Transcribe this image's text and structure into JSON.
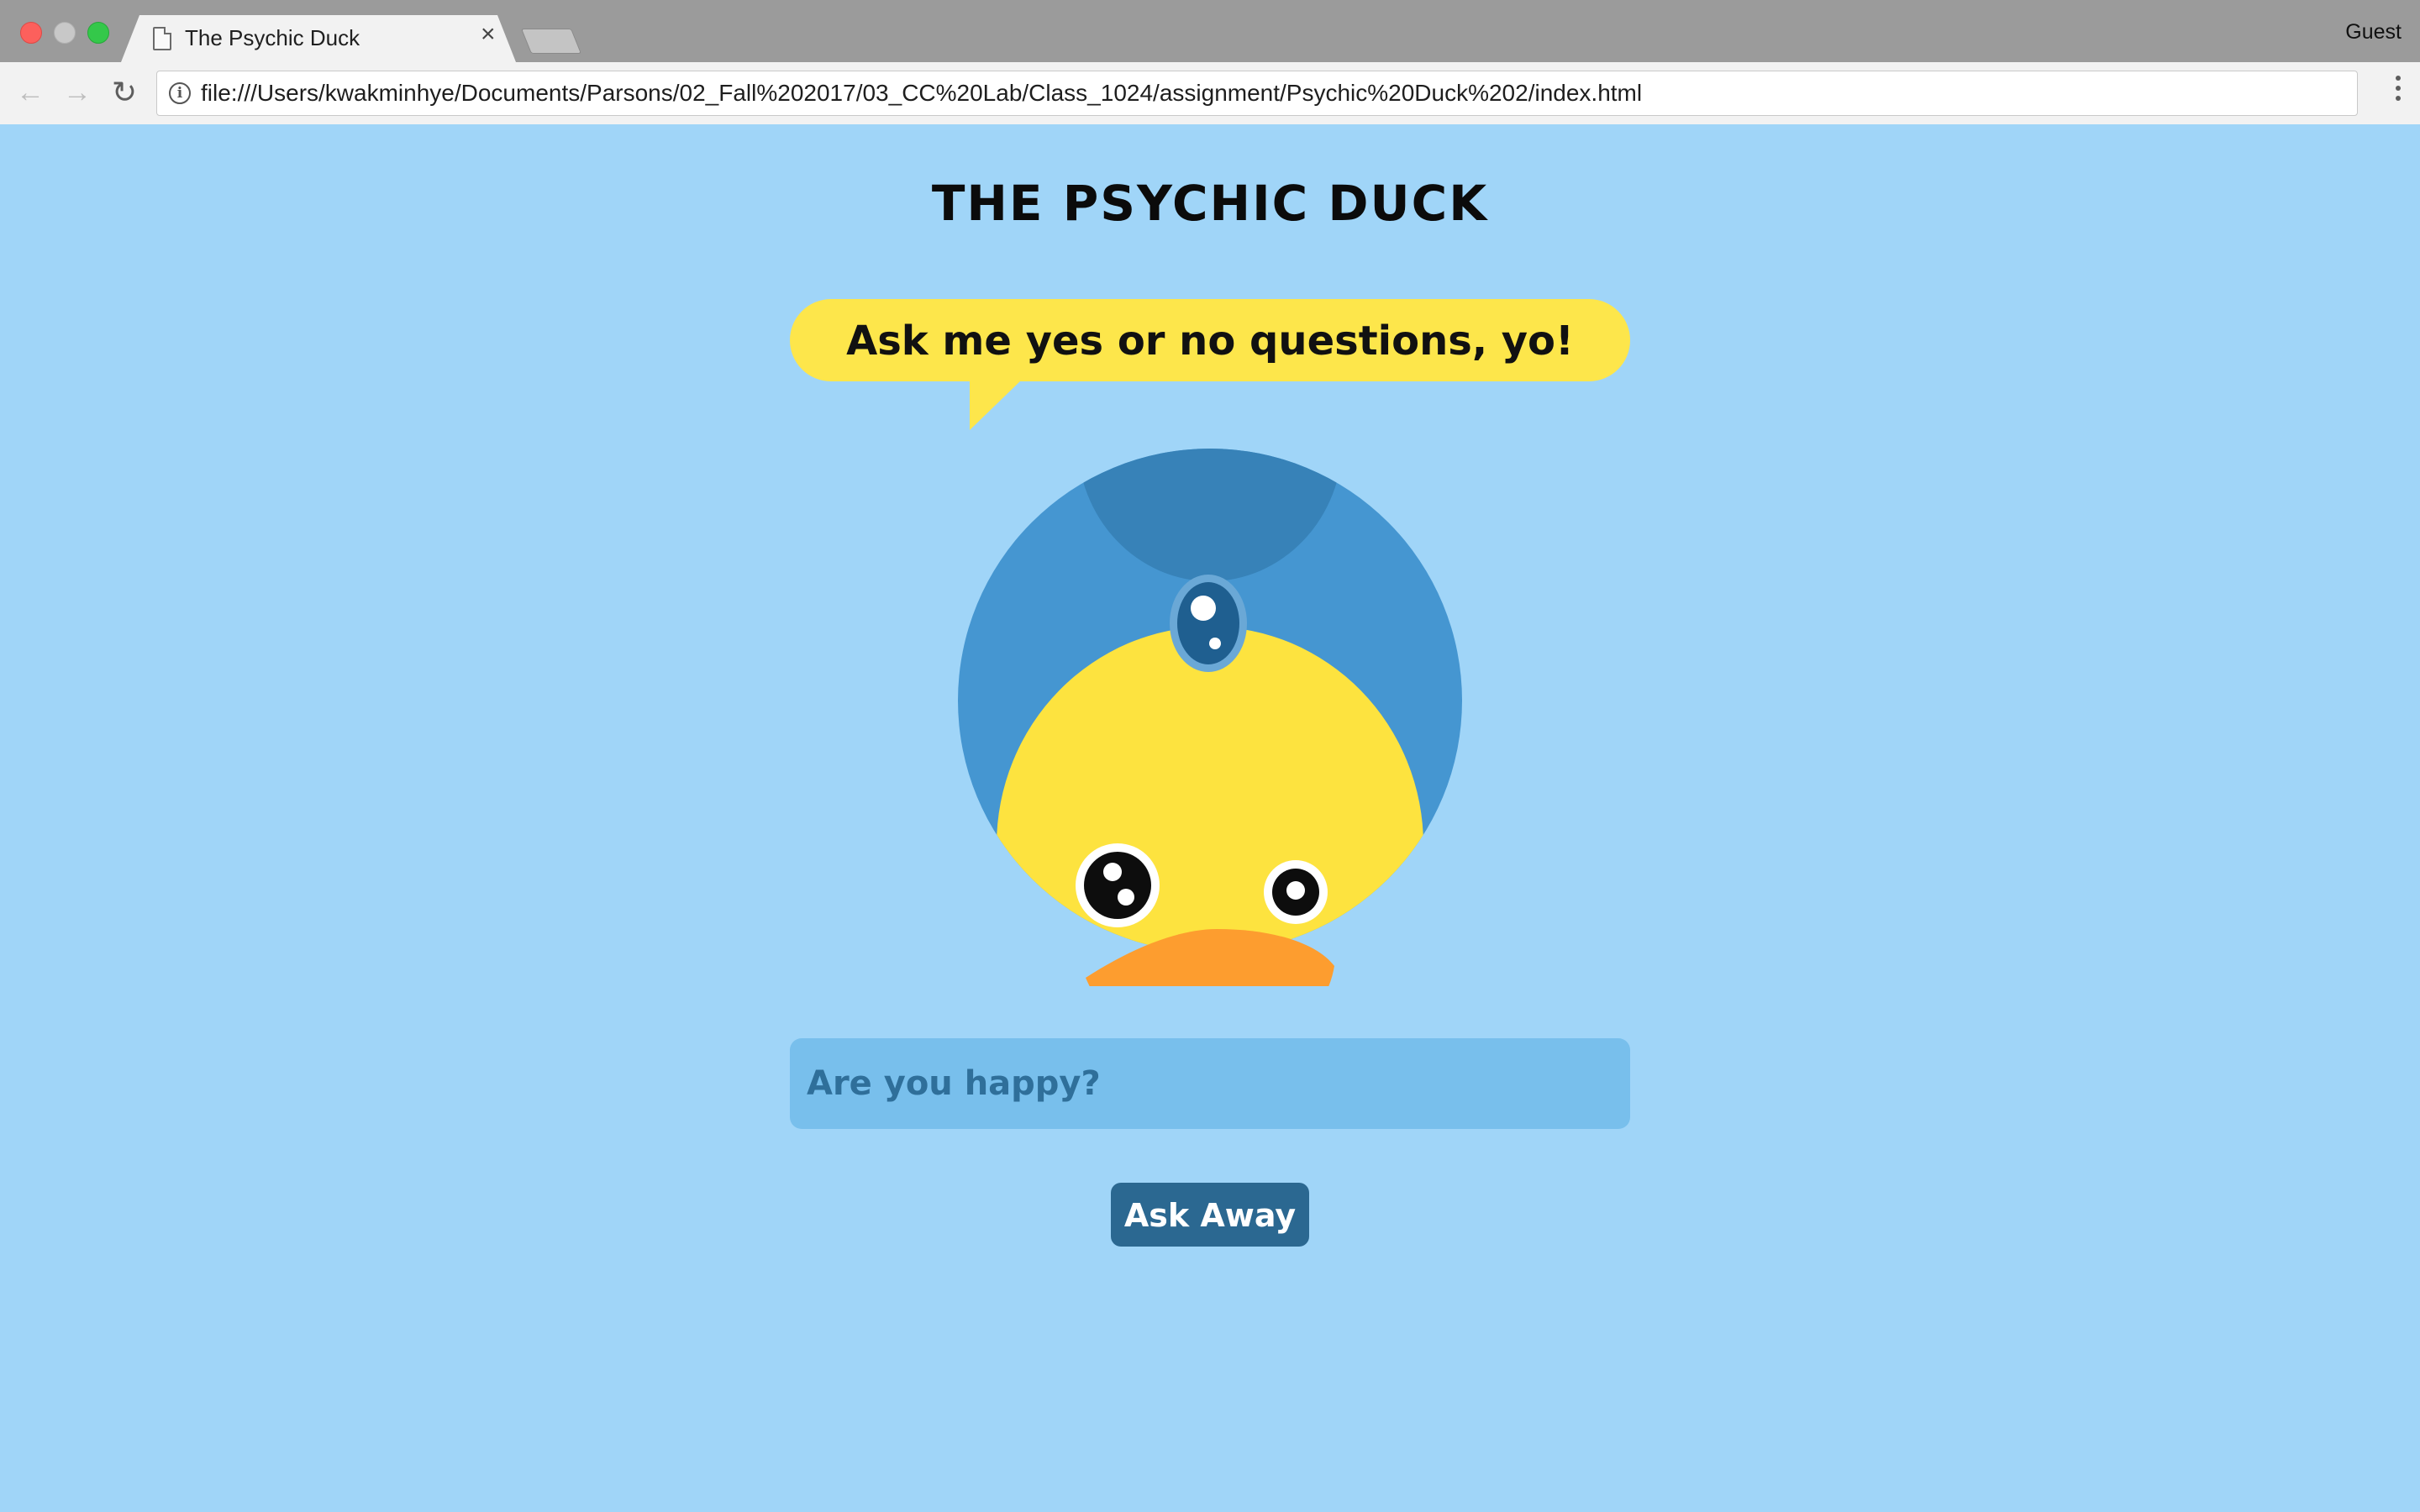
{
  "browser": {
    "tab_title": "The Psychic Duck",
    "tab_close": "×",
    "profile": "Guest",
    "url": "file:///Users/kwakminhye/Documents/Parsons/02_Fall%202017/03_CC%20Lab/Class_1024/assignment/Psychic%20Duck%202/index.html",
    "icons": [
      "page-icon",
      "close-icon",
      "back-arrow-icon",
      "forward-arrow-icon",
      "reload-icon",
      "info-icon",
      "menu-dots-icon"
    ]
  },
  "page": {
    "title": "THE PSYCHIC DUCK",
    "speech": "Ask me yes or no questions, yo!",
    "input_placeholder": "Are you happy?",
    "button_label": "Ask Away",
    "colors": {
      "background": "#a0d5f8",
      "bubble": "#fde64b",
      "turban": "#4596d1",
      "turban_top": "#3782b8",
      "duck_face": "#fde33f",
      "beak": "#fd9d2f",
      "input": "#78bfec",
      "button": "#2b6891"
    }
  }
}
